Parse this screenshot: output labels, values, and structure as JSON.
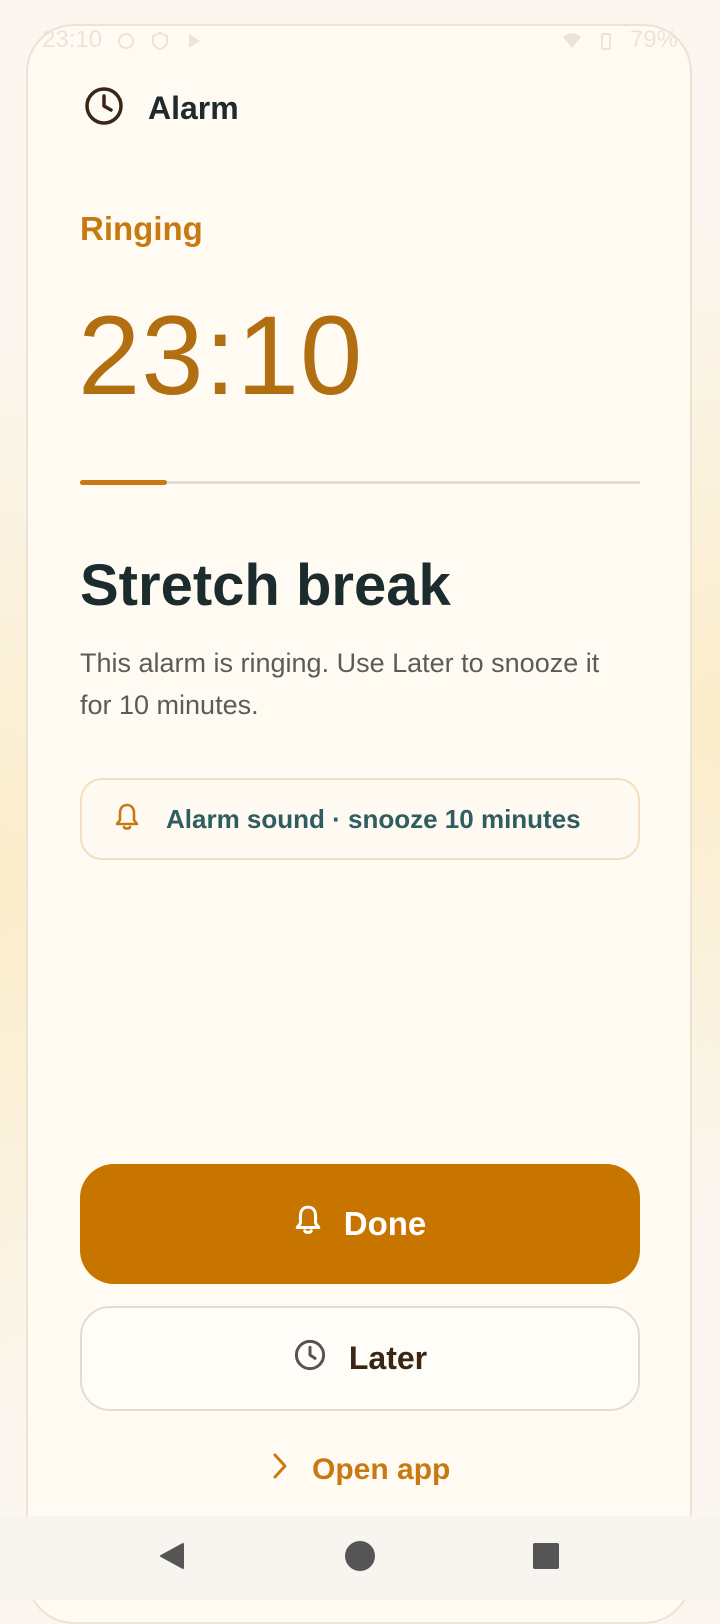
{
  "status_bar": {
    "time": "23:10",
    "battery": "79%"
  },
  "header": {
    "icon": "clock-icon",
    "title": "Alarm"
  },
  "alarm": {
    "state": "Ringing",
    "time": "23:10",
    "progress_fraction": 0.155,
    "title": "Stretch break",
    "description": "This alarm is ringing. Use Later to snooze it for 10 minutes."
  },
  "info": {
    "icon": "bell-icon",
    "text": "Alarm sound · snooze 10 minutes"
  },
  "actions": {
    "done_label": "Done",
    "later_label": "Later",
    "open_app_label": "Open app"
  },
  "colors": {
    "accent": "#c87500",
    "accent_text": "#c87a12",
    "time_text": "#b16f12",
    "title_text": "#1c2b2d",
    "info_text": "#2e5d62"
  }
}
